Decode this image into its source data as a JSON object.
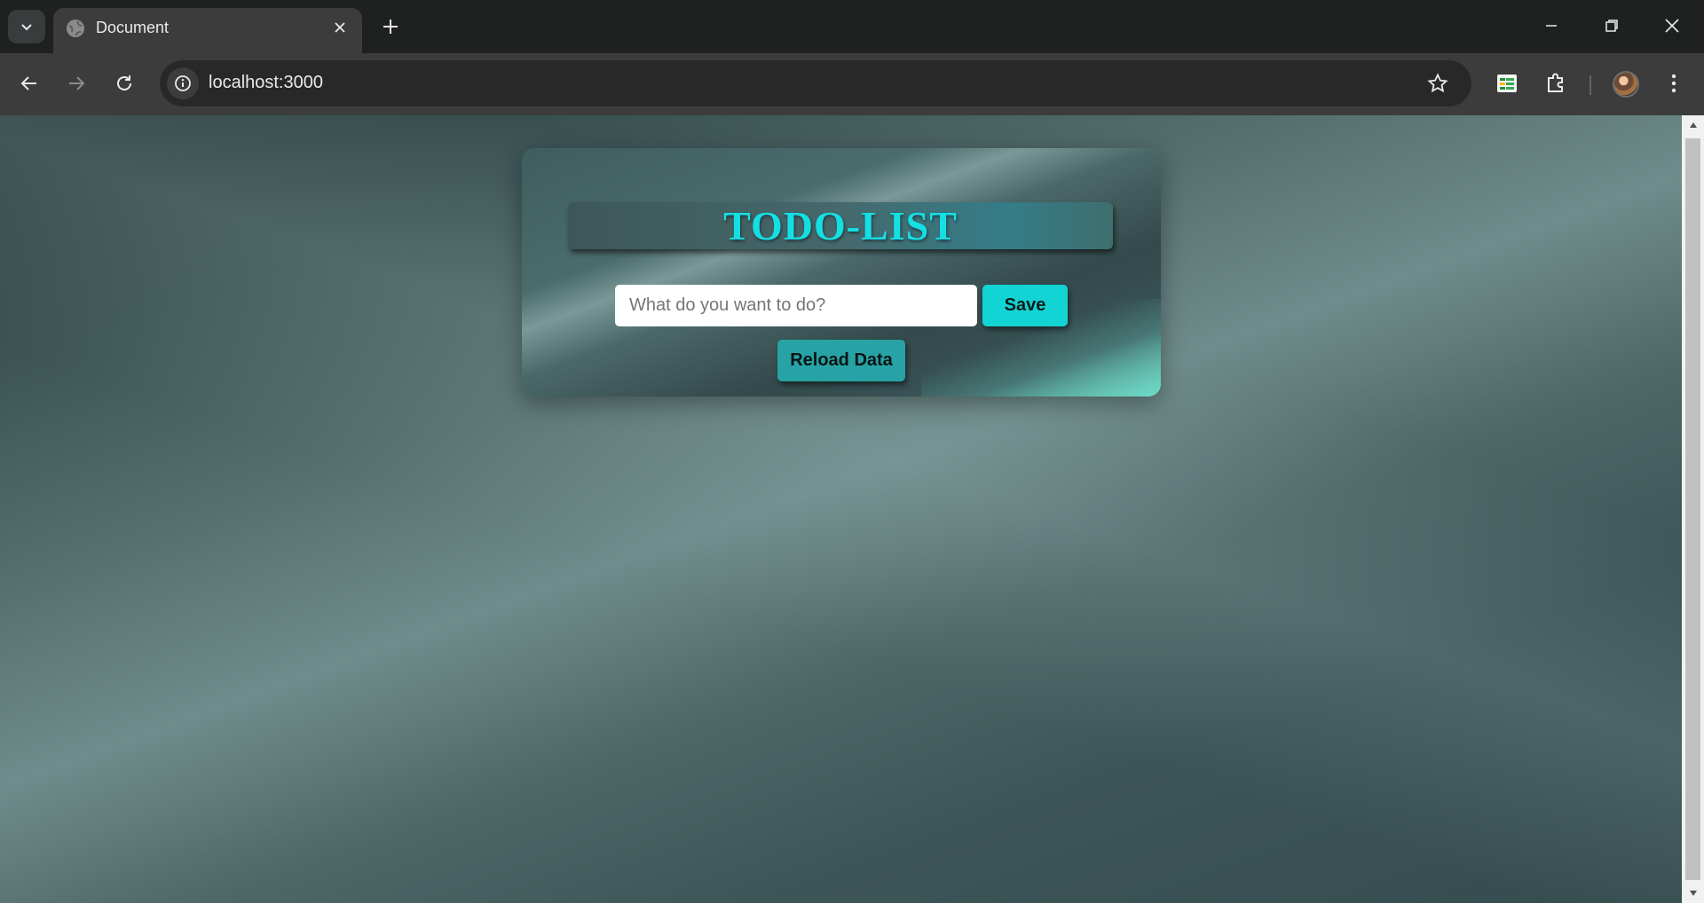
{
  "browser": {
    "tab": {
      "title": "Document"
    },
    "address_bar": {
      "url": "localhost:3000"
    }
  },
  "app": {
    "title": "TODO-LIST",
    "input": {
      "placeholder": "What do you want to do?",
      "value": ""
    },
    "save_label": "Save",
    "reload_label": "Reload Data"
  },
  "colors": {
    "title_text": "#14e0e4",
    "save_button": "#12d4d4",
    "reload_button": "#27a3a5"
  }
}
